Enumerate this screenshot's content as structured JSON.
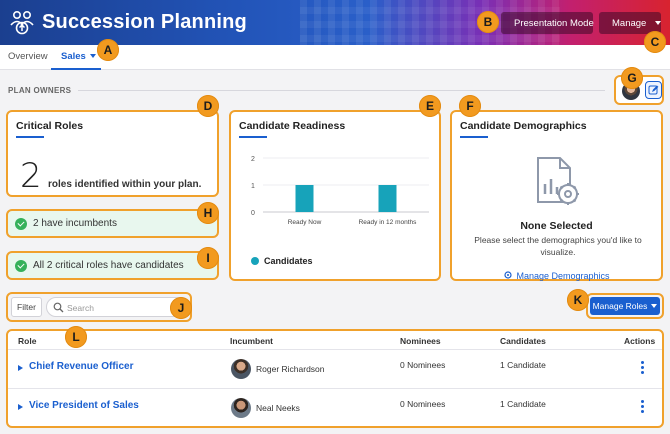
{
  "header": {
    "title": "Succession Planning",
    "presentation_label": "Presentation Mode",
    "manage_label": "Manage"
  },
  "tabs": {
    "overview": "Overview",
    "sales": "Sales"
  },
  "plan_owners_label": "PLAN OWNERS",
  "critical_roles": {
    "title": "Critical Roles",
    "count": "2",
    "text": "roles identified within your plan."
  },
  "status": {
    "incumbents": "2 have incumbents",
    "candidates": "All 2 critical roles have candidates"
  },
  "readiness": {
    "title": "Candidate Readiness",
    "legend": "Candidates"
  },
  "chart_data": {
    "type": "bar",
    "title": "Candidate Readiness",
    "categories": [
      "Ready Now",
      "Ready in 12 months"
    ],
    "series": [
      {
        "name": "Candidates",
        "values": [
          1,
          1
        ]
      }
    ],
    "yticks": [
      "0",
      "1",
      "2"
    ],
    "ylim": [
      0,
      2
    ],
    "color": "#17a3ba"
  },
  "demographics": {
    "title": "Candidate Demographics",
    "empty_title": "None Selected",
    "empty_message": "Please select the demographics you'd like to visualize.",
    "link": "Manage Demographics"
  },
  "toolbar": {
    "filter_label": "Filter",
    "search_placeholder": "Search",
    "manage_roles_label": "Manage Roles"
  },
  "table": {
    "headers": [
      "Role",
      "Incumbent",
      "Nominees",
      "Candidates",
      "Actions"
    ],
    "rows": [
      {
        "role": "Chief Revenue Officer",
        "incumbent": "Roger Richardson",
        "nominees": "0 Nominees",
        "candidates": "1 Candidate"
      },
      {
        "role": "Vice President of Sales",
        "incumbent": "Neal Neeks",
        "nominees": "0 Nominees",
        "candidates": "1 Candidate"
      }
    ]
  },
  "markers": [
    "A",
    "B",
    "C",
    "D",
    "E",
    "F",
    "G",
    "H",
    "I",
    "J",
    "K",
    "L"
  ],
  "colors": {
    "accent": "#1a5fcf",
    "highlight": "#f0a12c",
    "marker": "#f29a1f",
    "success": "#35b15a",
    "bar": "#17a3ba"
  }
}
